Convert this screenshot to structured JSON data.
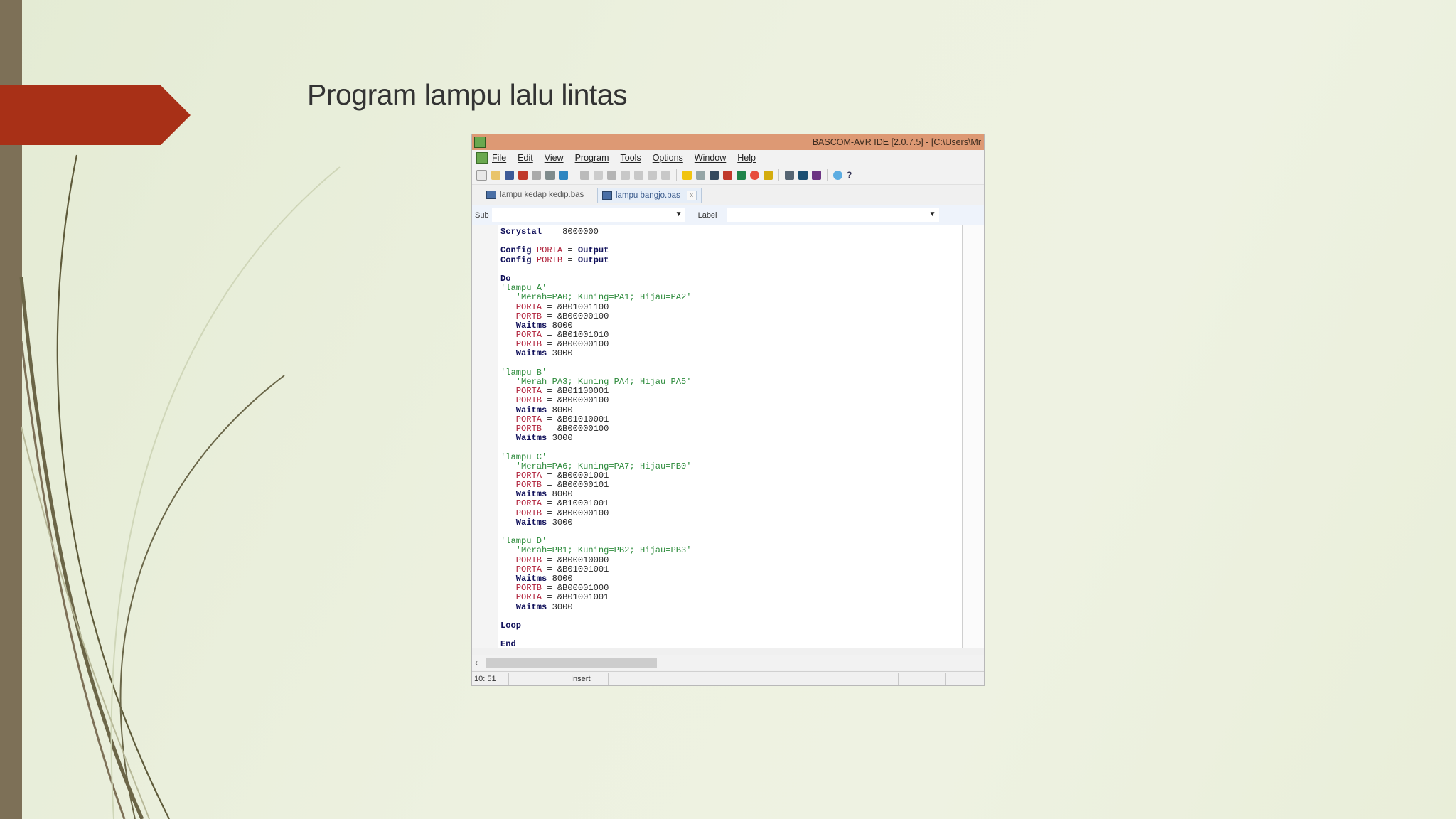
{
  "slide": {
    "title": "Program lampu lalu lintas",
    "accent_color": "#a83017",
    "strip_color": "#7d7057"
  },
  "window": {
    "title": "BASCOM-AVR IDE [2.0.7.5] - [C:\\Users\\Mr",
    "menu": [
      "File",
      "Edit",
      "View",
      "Program",
      "Tools",
      "Options",
      "Window",
      "Help"
    ],
    "tabs": [
      {
        "label": "lampu kedap kedip.bas",
        "active": false
      },
      {
        "label": "lampu bangjo.bas",
        "active": true
      }
    ],
    "sub_label": "Sub",
    "sub_value": "",
    "label_label": "Label",
    "label_value": ""
  },
  "code_lines": [
    [
      [
        "kw",
        "$crystal"
      ],
      [
        "",
        "  = 8000000"
      ]
    ],
    [],
    [
      [
        "kw",
        "Config "
      ],
      [
        "var",
        "PORTA"
      ],
      [
        "",
        " = "
      ],
      [
        "kw",
        "Output"
      ]
    ],
    [
      [
        "kw",
        "Config "
      ],
      [
        "var",
        "PORTB"
      ],
      [
        "",
        " = "
      ],
      [
        "kw",
        "Output"
      ]
    ],
    [],
    [
      [
        "kw",
        "Do"
      ]
    ],
    [
      [
        "cmt",
        "'lampu A'"
      ]
    ],
    [
      [
        "cmt",
        "   'Merah=PA0; Kuning=PA1; Hijau=PA2'"
      ]
    ],
    [
      [
        "var",
        "   PORTA"
      ],
      [
        "",
        " = &B01001100"
      ]
    ],
    [
      [
        "var",
        "   PORTB"
      ],
      [
        "",
        " = &B00000100"
      ]
    ],
    [
      [
        "kw",
        "   Waitms"
      ],
      [
        "",
        " 8000"
      ]
    ],
    [
      [
        "var",
        "   PORTA"
      ],
      [
        "",
        " = &B01001010"
      ]
    ],
    [
      [
        "var",
        "   PORTB"
      ],
      [
        "",
        " = &B00000100"
      ]
    ],
    [
      [
        "kw",
        "   Waitms"
      ],
      [
        "",
        " 3000"
      ]
    ],
    [],
    [
      [
        "cmt",
        "'lampu B'"
      ]
    ],
    [
      [
        "cmt",
        "   'Merah=PA3; Kuning=PA4; Hijau=PA5'"
      ]
    ],
    [
      [
        "var",
        "   PORTA"
      ],
      [
        "",
        " = &B01100001"
      ]
    ],
    [
      [
        "var",
        "   PORTB"
      ],
      [
        "",
        " = &B00000100"
      ]
    ],
    [
      [
        "kw",
        "   Waitms"
      ],
      [
        "",
        " 8000"
      ]
    ],
    [
      [
        "var",
        "   PORTA"
      ],
      [
        "",
        " = &B01010001"
      ]
    ],
    [
      [
        "var",
        "   PORTB"
      ],
      [
        "",
        " = &B00000100"
      ]
    ],
    [
      [
        "kw",
        "   Waitms"
      ],
      [
        "",
        " 3000"
      ]
    ],
    [],
    [
      [
        "cmt",
        "'lampu C'"
      ]
    ],
    [
      [
        "cmt",
        "   'Merah=PA6; Kuning=PA7; Hijau=PB0'"
      ]
    ],
    [
      [
        "var",
        "   PORTA"
      ],
      [
        "",
        " = &B00001001"
      ]
    ],
    [
      [
        "var",
        "   PORTB"
      ],
      [
        "",
        " = &B00000101"
      ]
    ],
    [
      [
        "kw",
        "   Waitms"
      ],
      [
        "",
        " 8000"
      ]
    ],
    [
      [
        "var",
        "   PORTA"
      ],
      [
        "",
        " = &B10001001"
      ]
    ],
    [
      [
        "var",
        "   PORTB"
      ],
      [
        "",
        " = &B00000100"
      ]
    ],
    [
      [
        "kw",
        "   Waitms"
      ],
      [
        "",
        " 3000"
      ]
    ],
    [],
    [
      [
        "cmt",
        "'lampu D'"
      ]
    ],
    [
      [
        "cmt",
        "   'Merah=PB1; Kuning=PB2; Hijau=PB3'"
      ]
    ],
    [
      [
        "var",
        "   PORTB"
      ],
      [
        "",
        " = &B00010000"
      ]
    ],
    [
      [
        "var",
        "   PORTA"
      ],
      [
        "",
        " = &B01001001"
      ]
    ],
    [
      [
        "kw",
        "   Waitms"
      ],
      [
        "",
        " 8000"
      ]
    ],
    [
      [
        "var",
        "   PORTB"
      ],
      [
        "",
        " = &B00001000"
      ]
    ],
    [
      [
        "var",
        "   PORTA"
      ],
      [
        "",
        " = &B01001001"
      ]
    ],
    [
      [
        "kw",
        "   Waitms"
      ],
      [
        "",
        " 3000"
      ]
    ],
    [],
    [
      [
        "kw",
        "Loop"
      ]
    ],
    [],
    [
      [
        "kw",
        "End"
      ]
    ]
  ],
  "status": {
    "position": "10: 51",
    "mode": "Insert"
  }
}
